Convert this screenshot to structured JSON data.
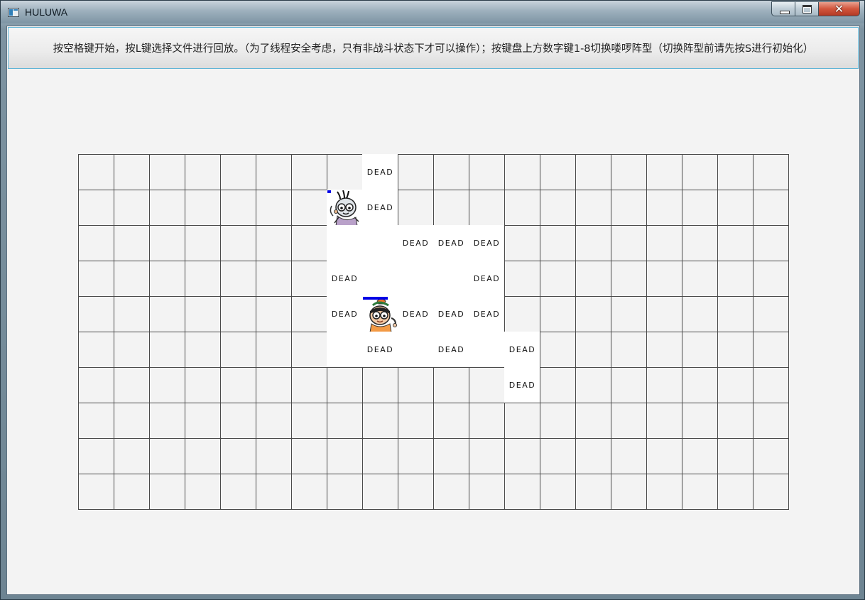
{
  "window": {
    "title": "HULUWA",
    "close_glyph": "✕"
  },
  "instruction": {
    "text": "按空格键开始，按L键选择文件进行回放。（为了线程安全考虑，只有非战斗状态下才可以操作）；按键盘上方数字键1-8切换喽啰阵型（切换阵型前请先按S进行初始化）"
  },
  "board": {
    "cols": 20,
    "rows": 10,
    "dead_label": "DEAD",
    "dead_cells": [
      [
        8,
        0
      ],
      [
        8,
        1
      ],
      [
        9,
        2
      ],
      [
        10,
        2
      ],
      [
        11,
        2
      ],
      [
        7,
        3
      ],
      [
        11,
        3
      ],
      [
        7,
        4
      ],
      [
        9,
        4
      ],
      [
        10,
        4
      ],
      [
        11,
        4
      ],
      [
        8,
        5
      ],
      [
        10,
        5
      ],
      [
        12,
        5
      ],
      [
        12,
        6
      ]
    ],
    "blank_cells": [
      [
        9,
        3
      ],
      [
        10,
        3
      ],
      [
        8,
        3
      ],
      [
        7,
        2
      ],
      [
        8,
        2
      ],
      [
        7,
        5
      ],
      [
        9,
        5
      ],
      [
        11,
        5
      ]
    ],
    "creatures": [
      {
        "name": "scorpion-demon",
        "icon": "villain-avatar-icon",
        "col": 7,
        "row": 1,
        "hp_fraction": 0.1
      },
      {
        "name": "calabash-grandpa",
        "icon": "hero-avatar-icon",
        "col": 8,
        "row": 4,
        "hp_fraction": 0.7
      }
    ]
  },
  "colors": {
    "hp_bar": "#0000e6",
    "grid_line": "#4a4a4a",
    "board_bg": "#f3f3f3"
  }
}
